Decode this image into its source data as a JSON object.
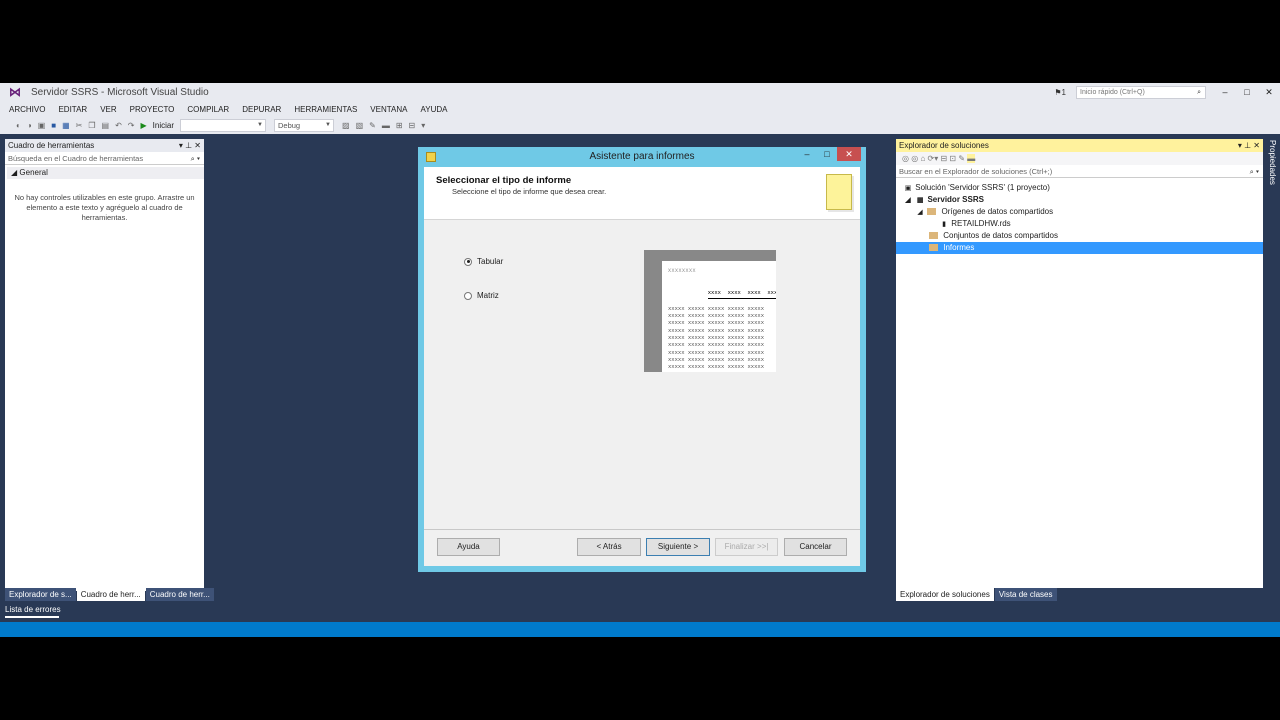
{
  "window": {
    "title": "Servidor SSRS - Microsoft Visual Studio",
    "notification_count": "1",
    "quick_launch_placeholder": "Inicio rápido (Ctrl+Q)"
  },
  "menu": [
    "ARCHIVO",
    "EDITAR",
    "VER",
    "PROYECTO",
    "COMPILAR",
    "DEPURAR",
    "HERRAMIENTAS",
    "VENTANA",
    "AYUDA"
  ],
  "toolbar": {
    "start_label": "Iniciar",
    "config": "Debug"
  },
  "toolbox": {
    "title": "Cuadro de herramientas",
    "search_placeholder": "Búsqueda en el Cuadro de herramientas",
    "group": "General",
    "empty_message": "No hay controles utilizables en este grupo. Arrastre un elemento a este texto y agréguelo al cuadro de herramientas.",
    "tabs": [
      "Explorador de s...",
      "Cuadro de herr...",
      "Cuadro de herr..."
    ]
  },
  "error_list_label": "Lista de errores",
  "solution_explorer": {
    "title": "Explorador de soluciones",
    "search_placeholder": "Buscar en el Explorador de soluciones (Ctrl+;)",
    "tree": {
      "solution": "Solución 'Servidor SSRS' (1 proyecto)",
      "project": "Servidor SSRS",
      "shared_sources": "Orígenes de datos compartidos",
      "datasource": "RETAILDHW.rds",
      "shared_datasets": "Conjuntos de datos compartidos",
      "reports": "Informes"
    },
    "tabs": [
      "Explorador de soluciones",
      "Vista de clases"
    ]
  },
  "properties_label": "Propiedades",
  "wizard": {
    "title": "Asistente para informes",
    "heading": "Seleccionar el tipo de informe",
    "subheading": "Seleccione el tipo de informe que desea crear.",
    "options": [
      {
        "label": "Tabular",
        "selected": true
      },
      {
        "label": "Matriz",
        "selected": false
      }
    ],
    "preview_title": "xxxxxxxx",
    "preview_header": "xxxx  xxxx  xxxx  xxxx  xxxx",
    "preview_row": "xxxxx xxxxx xxxxx xxxxx xxxxx",
    "buttons": {
      "help": "Ayuda",
      "back": "< Atrás",
      "next": "Siguiente >",
      "finish": "Finalizar >>|",
      "cancel": "Cancelar"
    }
  },
  "colors": {
    "ide_background": "#293955",
    "status_bar": "#007acc",
    "dialog_frame": "#6fc9e6",
    "selection": "#3399ff",
    "active_panel_header": "#fff29d"
  }
}
